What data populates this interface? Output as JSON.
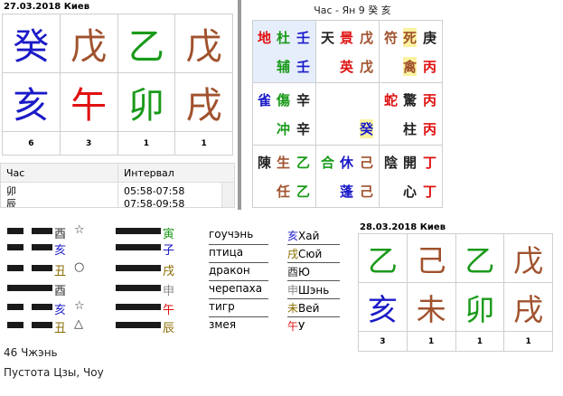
{
  "top_chart": {
    "date": "27.03.2018 Киев",
    "stems": [
      {
        "ch": "癸",
        "color": "#1a1ac8"
      },
      {
        "ch": "戊",
        "color": "#a0522d"
      },
      {
        "ch": "乙",
        "color": "#1a9a1a"
      },
      {
        "ch": "戊",
        "color": "#a0522d"
      }
    ],
    "branches": [
      {
        "ch": "亥",
        "color": "#1a1ac8"
      },
      {
        "ch": "午",
        "color": "#e01010"
      },
      {
        "ch": "卯",
        "color": "#1a9a1a"
      },
      {
        "ch": "戌",
        "color": "#a0522d"
      }
    ],
    "numbers": [
      "6",
      "3",
      "1",
      "1"
    ]
  },
  "interval_list": {
    "col_hour": "Час",
    "col_interval": "Интервал",
    "rows": [
      {
        "hour": "卯",
        "interval": "05:58-07:58"
      },
      {
        "hour": "辰",
        "interval": "07:58-09:58"
      }
    ]
  },
  "grid": {
    "title": "Час - Ян 9 癸 亥",
    "cells": [
      {
        "a": "地",
        "ac": "#e01010",
        "b": "杜",
        "bc": "#1a9a1a",
        "c": "壬",
        "cc": "#1a1ac8",
        "d": "",
        "dc": "",
        "e": "辅",
        "ec": "#1a9a1a",
        "f": "壬",
        "fc": "#1a1ac8",
        "bg": "#e6eefb"
      },
      {
        "a": "天",
        "ac": "#222",
        "b": "景",
        "bc": "#e01010",
        "c": "戊",
        "cc": "#a0522d",
        "d": "",
        "dc": "",
        "e": "英",
        "ec": "#e01010",
        "f": "戊",
        "fc": "#a0522d",
        "bg": "#fff"
      },
      {
        "a": "符",
        "ac": "#a0522d",
        "b": "死",
        "bc": "#a0522d",
        "c": "庚",
        "cc": "#222",
        "d": "",
        "dc": "",
        "e": "禽",
        "ec": "#a0522d",
        "f": "丙",
        "fc": "#e01010",
        "bg": "#fff"
      },
      {
        "a": "雀",
        "ac": "#1a1ac8",
        "b": "傷",
        "bc": "#1a9a1a",
        "c": "辛",
        "cc": "#222",
        "d": "",
        "dc": "",
        "e": "冲",
        "ec": "#1a9a1a",
        "f": "辛",
        "fc": "#222",
        "bg": "#fff"
      },
      {
        "a": "",
        "ac": "",
        "b": "",
        "bc": "",
        "c": "",
        "cc": "",
        "d": "",
        "dc": "",
        "e": "",
        "ec": "",
        "f": "癸",
        "fc": "#1a1ac8",
        "bg": "#fff"
      },
      {
        "a": "蛇",
        "ac": "#e01010",
        "b": "驚",
        "bc": "#222",
        "c": "丙",
        "cc": "#e01010",
        "d": "",
        "dc": "",
        "e": "柱",
        "ec": "#222",
        "f": "丙",
        "fc": "#e01010",
        "bg": "#fff"
      },
      {
        "a": "陳",
        "ac": "#222",
        "b": "生",
        "bc": "#a0522d",
        "c": "乙",
        "cc": "#1a9a1a",
        "d": "",
        "dc": "",
        "e": "任",
        "ec": "#a0522d",
        "f": "乙",
        "fc": "#1a9a1a",
        "bg": "#fff"
      },
      {
        "a": "合",
        "ac": "#1a9a1a",
        "b": "休",
        "bc": "#1a1ac8",
        "c": "己",
        "cc": "#a0522d",
        "d": "",
        "dc": "",
        "e": "蓬",
        "ec": "#1a1ac8",
        "f": "己",
        "fc": "#a0522d",
        "bg": "#fff"
      },
      {
        "a": "陰",
        "ac": "#222",
        "b": "開",
        "bc": "#222",
        "c": "丁",
        "cc": "#e01010",
        "d": "",
        "dc": "",
        "e": "心",
        "ec": "#222",
        "f": "丁",
        "fc": "#e01010",
        "bg": "#fff"
      }
    ]
  },
  "hexagram": {
    "left_labels": [
      {
        "ch": "酉",
        "color": "#333",
        "sym": "☆"
      },
      {
        "ch": "亥",
        "color": "#1a1ac8",
        "sym": ""
      },
      {
        "ch": "丑",
        "color": "#8a6d00",
        "sym": "○"
      },
      {
        "ch": "酉",
        "color": "#333",
        "sym": ""
      },
      {
        "ch": "亥",
        "color": "#1a1ac8",
        "sym": "☆"
      },
      {
        "ch": "丑",
        "color": "#8a6d00",
        "sym": "△"
      }
    ],
    "right_labels": [
      {
        "ch": "寅",
        "color": "#1a9a1a"
      },
      {
        "ch": "子",
        "color": "#1a1ac8"
      },
      {
        "ch": "戌",
        "color": "#8a6d00"
      },
      {
        "ch": "申",
        "color": "#888"
      },
      {
        "ch": "午",
        "color": "#e01010"
      },
      {
        "ch": "辰",
        "color": "#8a6d00"
      }
    ],
    "spirits": [
      "гоучэнь",
      "птица",
      "дракон",
      "черепаха",
      "тигр",
      "змея"
    ],
    "relatives": [
      {
        "ch": "亥",
        "chc": "#1a1ac8",
        "label": "Хай"
      },
      {
        "ch": "戌",
        "chc": "#8a6d00",
        "label": "Сюй"
      },
      {
        "ch": "酉",
        "chc": "#333",
        "label": "Ю"
      },
      {
        "ch": "申",
        "chc": "#888",
        "label": "Шэнь"
      },
      {
        "ch": "未",
        "chc": "#8a6d00",
        "label": "Вей"
      },
      {
        "ch": "午",
        "chc": "#e01010",
        "label": "У"
      }
    ],
    "name": "46 Чжэнь",
    "void": "Пустота Цзы, Чоу"
  },
  "bottom_chart": {
    "date": "28.03.2018 Киев",
    "stems": [
      {
        "ch": "乙",
        "color": "#1a9a1a"
      },
      {
        "ch": "己",
        "color": "#a0522d"
      },
      {
        "ch": "乙",
        "color": "#1a9a1a"
      },
      {
        "ch": "戊",
        "color": "#a0522d"
      }
    ],
    "branches": [
      {
        "ch": "亥",
        "color": "#1a1ac8"
      },
      {
        "ch": "未",
        "color": "#a0522d"
      },
      {
        "ch": "卯",
        "color": "#1a9a1a"
      },
      {
        "ch": "戌",
        "color": "#a0522d"
      }
    ],
    "numbers": [
      "3",
      "1",
      "1",
      "1"
    ]
  }
}
